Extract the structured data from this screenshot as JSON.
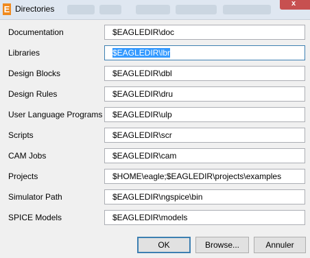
{
  "window": {
    "title": "Directories",
    "app_icon_letter": "E",
    "close_glyph": "x"
  },
  "rows": [
    {
      "label": "Documentation",
      "value": "$EAGLEDIR\\doc"
    },
    {
      "label": "Libraries",
      "value": "$EAGLEDIR\\lbr"
    },
    {
      "label": "Design Blocks",
      "value": "$EAGLEDIR\\dbl"
    },
    {
      "label": "Design Rules",
      "value": "$EAGLEDIR\\dru"
    },
    {
      "label": "User Language Programs",
      "value": "$EAGLEDIR\\ulp"
    },
    {
      "label": "Scripts",
      "value": "$EAGLEDIR\\scr"
    },
    {
      "label": "CAM Jobs",
      "value": "$EAGLEDIR\\cam"
    },
    {
      "label": "Projects",
      "value": "$HOME\\eagle;$EAGLEDIR\\projects\\examples"
    },
    {
      "label": "Simulator Path",
      "value": "$EAGLEDIR\\ngspice\\bin"
    },
    {
      "label": "SPICE Models",
      "value": "$EAGLEDIR\\models"
    }
  ],
  "buttons": {
    "ok": "OK",
    "browse": "Browse...",
    "cancel": "Annuler"
  },
  "colors": {
    "selection": "#3399ff",
    "focus_border": "#3c7fb1",
    "close": "#c75050"
  }
}
